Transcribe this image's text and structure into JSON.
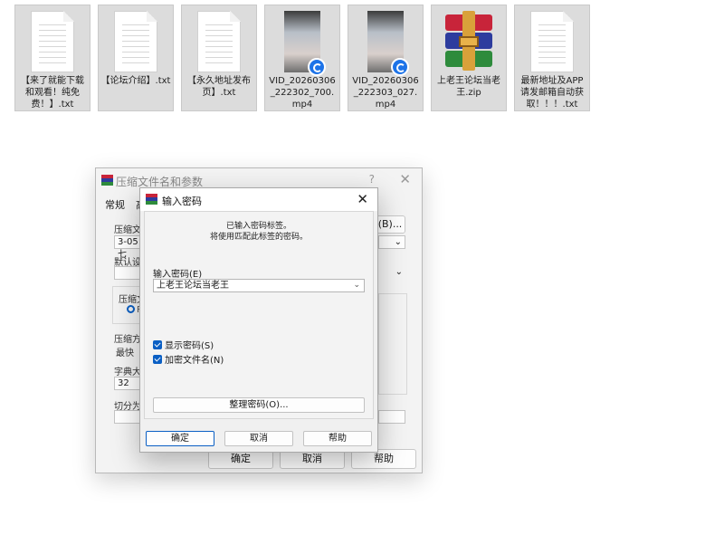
{
  "files": [
    {
      "name": "【来了就能下载和观看！纯免费！】.txt",
      "kind": "text"
    },
    {
      "name": "【论坛介绍】.txt",
      "kind": "text"
    },
    {
      "name": "【永久地址发布页】.txt",
      "kind": "text"
    },
    {
      "name": "VID_20260306_222302_700.mp4",
      "kind": "video"
    },
    {
      "name": "VID_20260306_222303_027.mp4",
      "kind": "video"
    },
    {
      "name": "上老王论坛当老王.zip",
      "kind": "archive"
    },
    {
      "name": "最新地址及APP请发邮箱自动获取！！！.txt",
      "kind": "text"
    }
  ],
  "back_dialog": {
    "title": "压缩文件名和参数",
    "help_glyph": "?",
    "close_glyph": "✕",
    "tab_general": "常规",
    "tab_advanced": "高",
    "archive_name_label": "压缩文",
    "archive_name_value": "3-05七",
    "browse_label": "(B)...",
    "default_profile_label": "默认设",
    "format_group_label": "压缩文",
    "radio_label": "R",
    "method_label": "压缩方",
    "method_value": "最快",
    "dict_label": "字典大小",
    "dict_value": "32",
    "split_label": "切分为",
    "ok_label": "确定",
    "cancel_label": "取消",
    "help_label": "帮助"
  },
  "password_dialog": {
    "title": "输入密码",
    "close_glyph": "✕",
    "message_line1": "已输入密码标签。",
    "message_line2": "将使用匹配此标签的密码。",
    "password_label": "输入密码(E)",
    "password_value": "上老王论坛当老王",
    "show_password_label": "显示密码(S)",
    "show_password_checked": true,
    "encrypt_names_label": "加密文件名(N)",
    "encrypt_names_checked": true,
    "organize_button": "整理密码(O)...",
    "ok_button": "确定",
    "cancel_button": "取消",
    "help_button": "帮助"
  },
  "icons": {
    "text_file": "text-document-icon",
    "video_file": "video-thumbnail-icon",
    "archive_file": "winrar-archive-icon",
    "app": "winrar-app-icon",
    "dropdown": "chevron-down-icon",
    "checkbox": "checkbox-checked-icon"
  },
  "colors": {
    "accent": "#0a5fc4",
    "rar_red": "#c8243a",
    "rar_blue": "#2d3c9e",
    "rar_green": "#2e8b3c",
    "rar_gold": "#d9a13a"
  }
}
